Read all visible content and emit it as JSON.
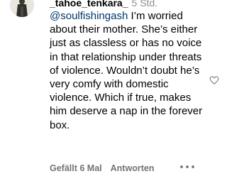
{
  "comment": {
    "username": "_tahoe_tenkara_",
    "timestamp": "5 Std.",
    "mention": "@soulfishingash",
    "text": " I’m worried about their mother. She’s either just as classless or has no voice in that relationship under threats of violence. Wouldn’t doubt he’s very comfy with domestic violence. Which if true, makes him deserve a nap in the forever box."
  },
  "actions": {
    "likes_label": "Gefällt 6 Mal",
    "reply_label": "Antworten"
  },
  "icons": {
    "avatar": "avatar-photo",
    "like": "heart-icon",
    "more": "more-options-icon"
  },
  "colors": {
    "text": "#000000",
    "mention": "#00376b",
    "secondary": "#737373",
    "timestamp": "#8e8e8e"
  }
}
